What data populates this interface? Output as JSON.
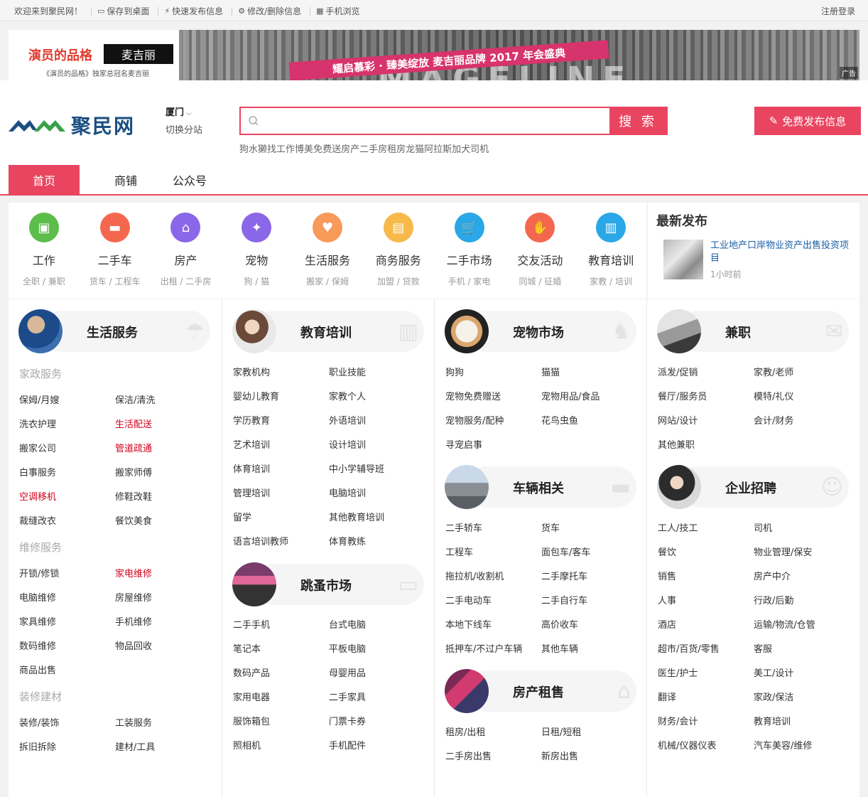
{
  "topbar": {
    "welcome": "欢迎来到聚民网！",
    "links": [
      {
        "icon": "monitor-icon",
        "label": "保存到桌面"
      },
      {
        "icon": "lightning-icon",
        "label": "快速发布信息"
      },
      {
        "icon": "gear-icon",
        "label": "修改/删除信息"
      },
      {
        "icon": "qrcode-icon",
        "label": "手机浏览"
      }
    ],
    "register": "注册",
    "login": "登录"
  },
  "banner": {
    "brand_a": "演员的品格",
    "brand_b": "麦吉丽",
    "sub": "《演员的品格》独家总冠名麦吉丽",
    "slogan": "耀启慕彩 · 臻美绽放 麦吉丽品牌 2017 年会盛典",
    "big": "MAGELINE",
    "ad_tag": "广告"
  },
  "header": {
    "logo_name": "聚民网",
    "city": "厦门",
    "switch_city": "切换分站",
    "search_placeholder": "",
    "search_button": "搜 索",
    "hot_keywords": [
      "狗",
      "水獭",
      "找工作",
      "博美",
      "免费送",
      "房产",
      "二手房",
      "租房",
      "龙猫",
      "阿拉斯加犬",
      "司机"
    ],
    "publish_button": "免费发布信息",
    "nav": [
      "首页",
      "商铺",
      "公众号"
    ]
  },
  "categories": [
    {
      "title": "工作",
      "sub": "全职 / 兼职",
      "color": "#5cbd4b",
      "icon": "briefcase-icon"
    },
    {
      "title": "二手车",
      "sub": "货车 / 工程车",
      "color": "#f4674f",
      "icon": "car-icon"
    },
    {
      "title": "房产",
      "sub": "出租 / 二手房",
      "color": "#8a66e8",
      "icon": "house-icon"
    },
    {
      "title": "宠物",
      "sub": "狗 / 猫",
      "color": "#8a66e8",
      "icon": "dog-icon"
    },
    {
      "title": "生活服务",
      "sub": "搬家 / 保姆",
      "color": "#f79a5a",
      "icon": "heart-hand-icon"
    },
    {
      "title": "商务服务",
      "sub": "加盟 / 贷款",
      "color": "#f7b94a",
      "icon": "shop-icon"
    },
    {
      "title": "二手市场",
      "sub": "手机 / 家电",
      "color": "#2aa7e6",
      "icon": "cart-icon"
    },
    {
      "title": "交友活动",
      "sub": "同城 / 征婚",
      "color": "#f4674f",
      "icon": "handshake-icon"
    },
    {
      "title": "教育培训",
      "sub": "家教 / 培训",
      "color": "#2aa7e6",
      "icon": "book-icon"
    }
  ],
  "latest": {
    "heading": "最新发布",
    "title": "工业地产口岸物业资产出售投资项目",
    "time": "1小时前"
  },
  "sections": {
    "life": {
      "title": "生活服务",
      "groups": [
        {
          "name": "家政服务",
          "items": [
            {
              "t": "保姆/月嫂"
            },
            {
              "t": "保洁/清洗"
            },
            {
              "t": "洗衣护理"
            },
            {
              "t": "生活配送",
              "red": true
            },
            {
              "t": "搬家公司"
            },
            {
              "t": "管道疏通",
              "red": true
            },
            {
              "t": "白事服务"
            },
            {
              "t": "搬家师傅"
            },
            {
              "t": "空调移机",
              "red": true
            },
            {
              "t": "修鞋改鞋"
            },
            {
              "t": "裁缝改衣"
            },
            {
              "t": "餐饮美食"
            }
          ]
        },
        {
          "name": "维修服务",
          "items": [
            {
              "t": "开锁/修锁"
            },
            {
              "t": "家电维修",
              "red": true
            },
            {
              "t": "电脑维修"
            },
            {
              "t": "房屋维修"
            },
            {
              "t": "家具维修"
            },
            {
              "t": "手机维修"
            },
            {
              "t": "数码维修"
            },
            {
              "t": "物品回收"
            },
            {
              "t": "商品出售"
            }
          ]
        },
        {
          "name": "装修建材",
          "items": [
            {
              "t": "装修/装饰"
            },
            {
              "t": "工装服务"
            },
            {
              "t": "拆旧拆除"
            },
            {
              "t": "建材/工具"
            }
          ]
        }
      ]
    },
    "edu": {
      "title": "教育培训",
      "items": [
        "家教机构",
        "职业技能",
        "婴幼儿教育",
        "家教个人",
        "学历教育",
        "外语培训",
        "艺术培训",
        "设计培训",
        "体育培训",
        "中小学辅导班",
        "管理培训",
        "电脑培训",
        "留学",
        "其他教育培训",
        "语言培训教师",
        "体育教练"
      ]
    },
    "flea": {
      "title": "跳蚤市场",
      "items": [
        "二手手机",
        "台式电脑",
        "笔记本",
        "平板电脑",
        "数码产品",
        "母婴用品",
        "家用电器",
        "二手家具",
        "服饰箱包",
        "门票卡券",
        "照相机",
        "手机配件"
      ]
    },
    "pet": {
      "title": "宠物市场",
      "items": [
        "狗狗",
        "猫猫",
        "宠物免费赠送",
        "宠物用品/食品",
        "宠物服务/配种",
        "花鸟虫鱼",
        "寻宠启事"
      ]
    },
    "car": {
      "title": "车辆相关",
      "items": [
        "二手轿车",
        "货车",
        "工程车",
        "面包车/客车",
        "拖拉机/收割机",
        "二手摩托车",
        "二手电动车",
        "二手自行车",
        "本地下线车",
        "高价收车",
        "抵押车/不过户车辆",
        "其他车辆"
      ]
    },
    "house": {
      "title": "房产租售",
      "items": [
        "租房/出租",
        "日租/短租",
        "二手房出售",
        "新房出售"
      ]
    },
    "parttime": {
      "title": "兼职",
      "items": [
        "派发/促销",
        "家教/老师",
        "餐厅/服务员",
        "模特/礼仪",
        "网站/设计",
        "会计/财务",
        "其他兼职"
      ]
    },
    "jobs": {
      "title": "企业招聘",
      "items": [
        "工人/技工",
        "司机",
        "餐饮",
        "物业管理/保安",
        "销售",
        "房产中介",
        "人事",
        "行政/后勤",
        "酒店",
        "运输/物流/仓管",
        "超市/百货/零售",
        "客服",
        "医生/护士",
        "美工/设计",
        "翻译",
        "家政/保洁",
        "财务/会计",
        "教育培训",
        "机械/仪器仪表",
        "汽车美容/维修"
      ]
    }
  },
  "colors": {
    "accent": "#e94560",
    "link": "#1b5fa5",
    "logo": "#1b4f80"
  }
}
